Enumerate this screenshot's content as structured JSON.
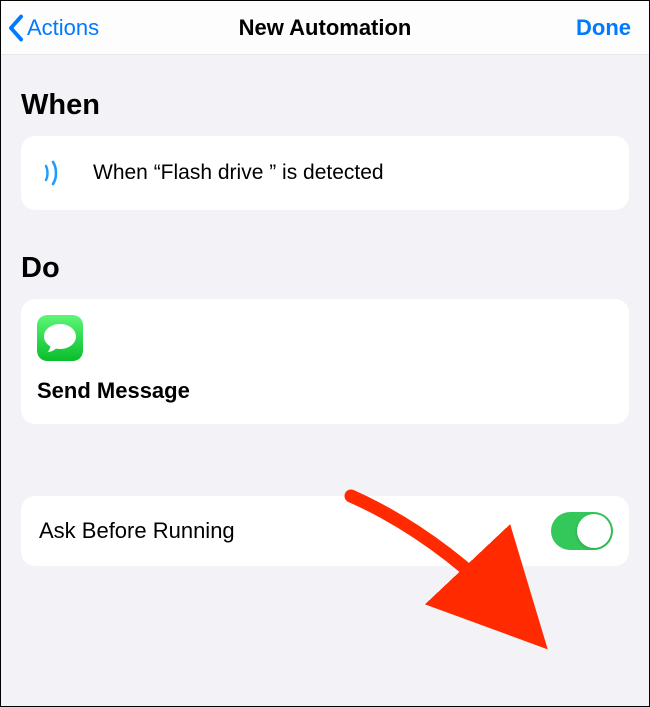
{
  "header": {
    "back_label": "Actions",
    "title": "New Automation",
    "done_label": "Done"
  },
  "sections": {
    "when": {
      "heading": "When",
      "item_text": "When “Flash drive ” is detected"
    },
    "do": {
      "heading": "Do",
      "action_label": "Send Message"
    },
    "ask": {
      "label": "Ask Before Running",
      "enabled": true
    }
  },
  "colors": {
    "ios_blue": "#007aff",
    "ios_green": "#34c759",
    "background": "#f2f2f7"
  }
}
